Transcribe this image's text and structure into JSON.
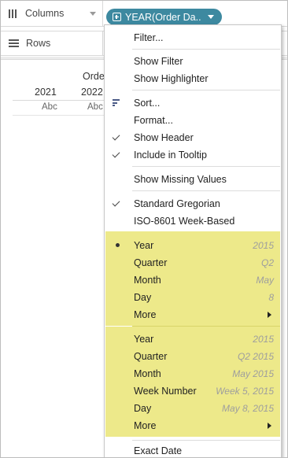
{
  "shelves": {
    "columns_label": "Columns",
    "rows_label": "Rows",
    "pill_label": "YEAR(Order Da.."
  },
  "view": {
    "header_title": "Order",
    "years": [
      "2021",
      "2022"
    ],
    "cells": [
      "Abc",
      "Abc"
    ]
  },
  "menu": {
    "filter": "Filter...",
    "show_filter": "Show Filter",
    "show_highlighter": "Show Highlighter",
    "sort": "Sort...",
    "format": "Format...",
    "show_header": "Show Header",
    "include_tooltip": "Include in Tooltip",
    "show_missing": "Show Missing Values",
    "standard_gregorian": "Standard Gregorian",
    "iso_week": "ISO-8601 Week-Based",
    "discrete": [
      {
        "label": "Year",
        "value": "2015"
      },
      {
        "label": "Quarter",
        "value": "Q2"
      },
      {
        "label": "Month",
        "value": "May"
      },
      {
        "label": "Day",
        "value": "8"
      },
      {
        "label": "More",
        "value": ""
      }
    ],
    "continuous": [
      {
        "label": "Year",
        "value": "2015"
      },
      {
        "label": "Quarter",
        "value": "Q2 2015"
      },
      {
        "label": "Month",
        "value": "May 2015"
      },
      {
        "label": "Week Number",
        "value": "Week 5, 2015"
      },
      {
        "label": "Day",
        "value": "May 8, 2015"
      },
      {
        "label": "More",
        "value": ""
      }
    ],
    "exact_date": "Exact Date"
  },
  "colors": {
    "pill": "#3d89a0",
    "highlight": "#ede98a",
    "value_text": "#9e9e9e"
  },
  "icons": {
    "columns": "columns-icon",
    "rows": "rows-icon",
    "pill": "plus-box-icon",
    "sort": "sort-icon",
    "check": "checkmark-icon",
    "bullet": "bullet-icon",
    "submenu": "submenu-arrow-icon"
  }
}
